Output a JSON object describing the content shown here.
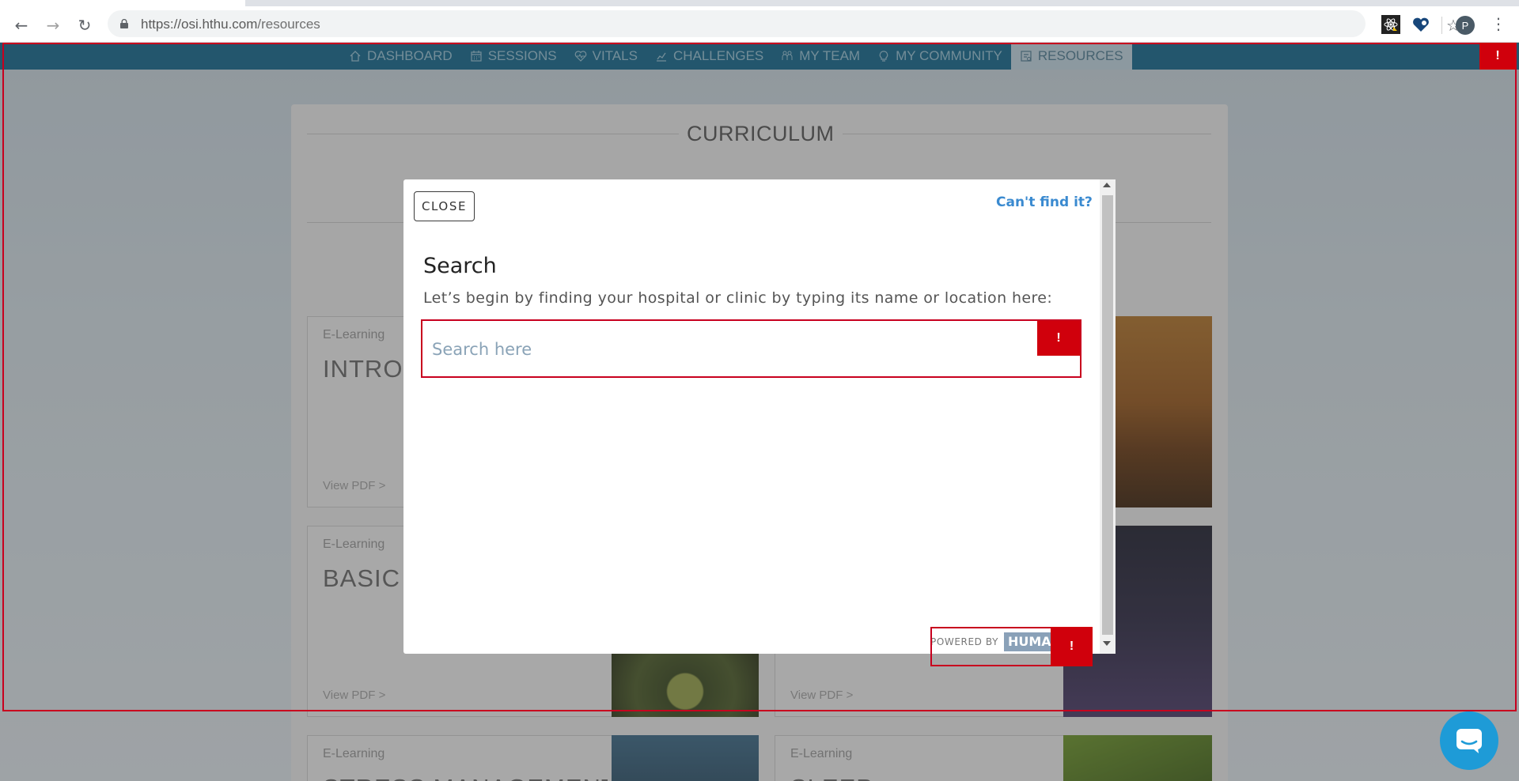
{
  "browser": {
    "url_host": "https://osi.hthu.com",
    "url_path": "/resources",
    "profile_initial": "P"
  },
  "nav": {
    "items": [
      {
        "label": "DASHBOARD",
        "icon": "home-icon"
      },
      {
        "label": "SESSIONS",
        "icon": "calendar-icon"
      },
      {
        "label": "VITALS",
        "icon": "heart-pulse-icon"
      },
      {
        "label": "CHALLENGES",
        "icon": "chart-icon"
      },
      {
        "label": "MY TEAM",
        "icon": "team-icon"
      },
      {
        "label": "MY COMMUNITY",
        "icon": "lightbulb-icon"
      },
      {
        "label": "RESOURCES",
        "icon": "resources-icon",
        "active": true
      }
    ]
  },
  "page": {
    "section_title": "CURRICULUM",
    "cards": [
      {
        "category": "E-Learning",
        "title": "INTROD",
        "link": "View PDF >"
      },
      {
        "category": "E-Learning",
        "title": "BASIC N",
        "link": "View PDF >"
      },
      {
        "category": "",
        "title": "",
        "link": "View PDF >"
      },
      {
        "category": "E-Learning",
        "title": "STRESS MANAGEMENT",
        "link": ""
      },
      {
        "category": "E-Learning",
        "title": "SLEEP",
        "link": ""
      }
    ]
  },
  "modal": {
    "close_label": "CLOSE",
    "cant_find": "Can't find it?",
    "title": "Search",
    "description": "Let’s begin by finding your hospital or clinic by typing its name or location here:",
    "search_placeholder": "Search here",
    "search_value": "",
    "powered_by": "POWERED BY",
    "powered_logo": "HUMA"
  },
  "flags": {
    "symbol": "!"
  },
  "colors": {
    "nav_bg": "#126a92",
    "accent_link": "#3a8ad0",
    "flag_red": "#d0000c",
    "intercom": "#1e9bd7"
  }
}
